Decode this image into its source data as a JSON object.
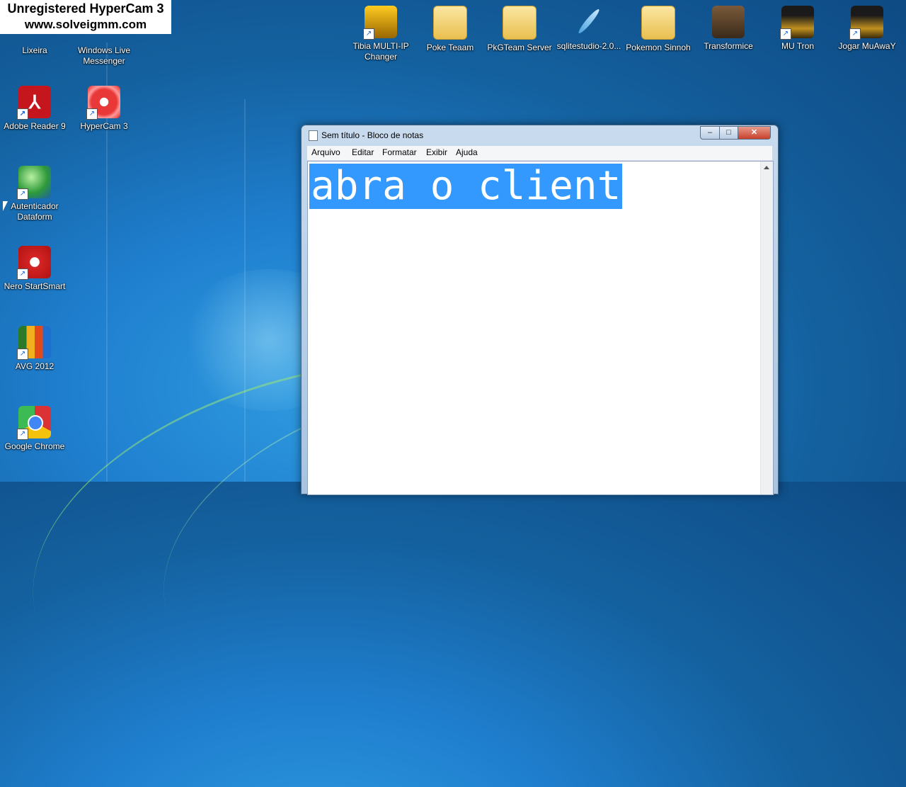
{
  "watermark": {
    "line1": "Unregistered HyperCam 3",
    "line2": "www.solveigmm.com"
  },
  "desktop_left": [
    {
      "label1": "Lixeira",
      "label2": ""
    },
    {
      "label1": "Windows Live",
      "label2": "Messenger"
    },
    {
      "label1": "Adobe Reader 9",
      "label2": ""
    },
    {
      "label1": "HyperCam 3",
      "label2": ""
    },
    {
      "label1": "Autenticador",
      "label2": "Dataform"
    },
    {
      "label1": "Nero StartSmart",
      "label2": ""
    },
    {
      "label1": "AVG 2012",
      "label2": ""
    },
    {
      "label1": "Google Chrome",
      "label2": ""
    }
  ],
  "desktop_top": [
    {
      "label1": "Tibia MULTI-IP",
      "label2": "Changer"
    },
    {
      "label1": "Poke Teaam",
      "label2": ""
    },
    {
      "label1": "PkGTeam Server",
      "label2": ""
    },
    {
      "label1": "sqlitestudio-2.0...",
      "label2": ""
    },
    {
      "label1": "Pokemon Sinnoh",
      "label2": ""
    },
    {
      "label1": "Transformice",
      "label2": ""
    },
    {
      "label1": "MU Tron",
      "label2": ""
    },
    {
      "label1": "Jogar MuAwaY",
      "label2": ""
    }
  ],
  "notepad": {
    "title": "Sem título - Bloco de notas",
    "menu": [
      "Arquivo",
      "Editar",
      "Formatar",
      "Exibir",
      "Ajuda"
    ],
    "content": "abra o client",
    "btn_min": "–",
    "btn_max": "□",
    "btn_close": "✕"
  },
  "colors": {
    "selection": "#3399ff",
    "desktop": "#1f7fcf"
  }
}
